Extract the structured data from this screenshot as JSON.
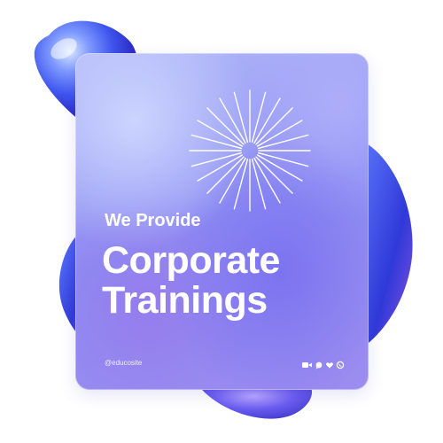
{
  "card": {
    "subtitle": "We Provide",
    "headline_line1": "Corporate",
    "headline_line2": "Trainings",
    "handle": "@educosite"
  },
  "icons": [
    "video-icon",
    "chat-icon",
    "heart-icon",
    "phone-icon"
  ],
  "colors": {
    "text": "#ffffff",
    "blob_light": "#cfe0ff",
    "blob_mid": "#4a63f0",
    "blob_dark": "#2a2fc9",
    "card_accent": "#8d8ef3"
  }
}
